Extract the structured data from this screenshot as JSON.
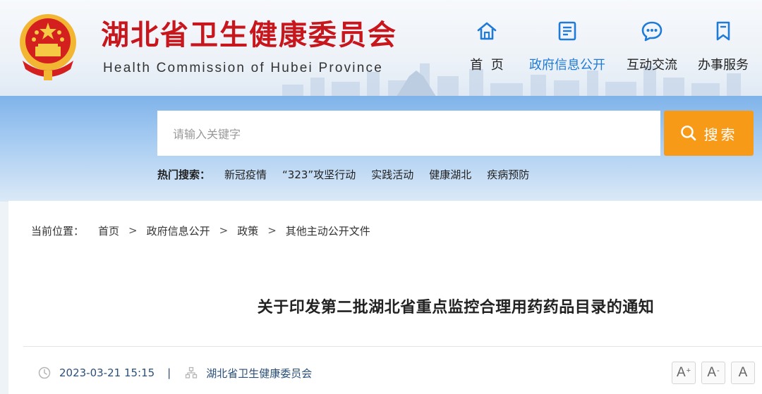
{
  "header": {
    "site_title": "湖北省卫生健康委员会",
    "site_subtitle": "Health Commission of Hubei Province",
    "nav": [
      {
        "label": "首  页",
        "icon": "home-icon",
        "active": false
      },
      {
        "label": "政府信息公开",
        "icon": "document-list-icon",
        "active": true
      },
      {
        "label": "互动交流",
        "icon": "chat-bubble-icon",
        "active": false
      },
      {
        "label": "办事服务",
        "icon": "bookmark-icon",
        "active": false
      }
    ]
  },
  "search": {
    "placeholder": "请输入关键字",
    "button_label": "搜索",
    "hot_label": "热门搜索：",
    "hot_items": [
      "新冠疫情",
      "“323”攻坚行动",
      "实践活动",
      "健康湖北",
      "疾病预防"
    ]
  },
  "breadcrumb": {
    "prefix": "当前位置：",
    "items": [
      "首页",
      "政府信息公开",
      "政策",
      "其他主动公开文件"
    ],
    "separator": ">"
  },
  "article": {
    "title": "关于印发第二批湖北省重点监控合理用药药品目录的通知",
    "date": "2023-03-21 15:15",
    "separator": "|",
    "source": "湖北省卫生健康委员会"
  },
  "font_controls": {
    "increase": "A",
    "increase_mark": "+",
    "decrease": "A",
    "decrease_mark": "-",
    "reset": "A"
  },
  "colors": {
    "brand_red": "#c8161d",
    "accent_blue": "#1f7bd6",
    "search_orange": "#f79a18"
  }
}
